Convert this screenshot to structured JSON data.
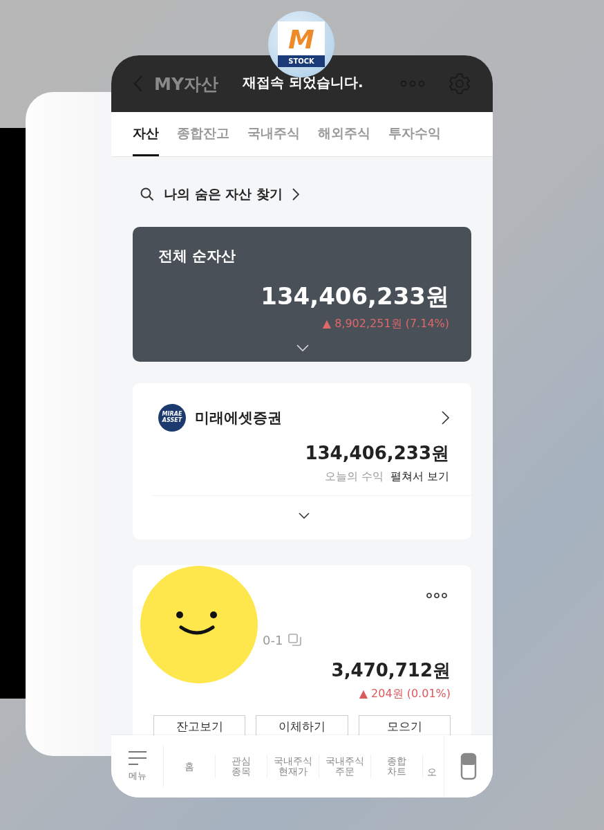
{
  "app_icon": {
    "letter": "M",
    "label": "STOCK"
  },
  "header": {
    "title": "MY자산",
    "toast": "재접속 되었습니다."
  },
  "tabs": [
    {
      "label": "자산",
      "selected": true
    },
    {
      "label": "종합잔고",
      "selected": false
    },
    {
      "label": "국내주식",
      "selected": false
    },
    {
      "label": "해외주식",
      "selected": false
    },
    {
      "label": "투자수익",
      "selected": false
    }
  ],
  "search": {
    "label": "나의 숨은 자산 찾기"
  },
  "summary": {
    "title": "전체 순자산",
    "amount": "134,406,233원",
    "change": "▲ 8,902,251원 (7.14%)"
  },
  "broker": {
    "logo_lines": [
      "MIRAE",
      "ASSET"
    ],
    "name": "미래에셋증권",
    "amount": "134,406,233원",
    "today_label": "오늘의 수익",
    "expand": "펼쳐서 보기"
  },
  "account": {
    "number": "0-1",
    "amount": "3,470,712원",
    "change": "▲ 204원 (0.01%)",
    "buttons": [
      "잔고보기",
      "이체하기",
      "모으기"
    ]
  },
  "bottom_nav": [
    {
      "kind": "menu",
      "label": "메뉴"
    },
    {
      "kind": "item",
      "label": "홈"
    },
    {
      "kind": "item",
      "label": "관심\n종목"
    },
    {
      "kind": "item",
      "label": "국내주식\n현재가"
    },
    {
      "kind": "item",
      "label": "국내주식\n주문"
    },
    {
      "kind": "item",
      "label": "종합\n차트"
    },
    {
      "kind": "cut",
      "label": "오"
    }
  ]
}
